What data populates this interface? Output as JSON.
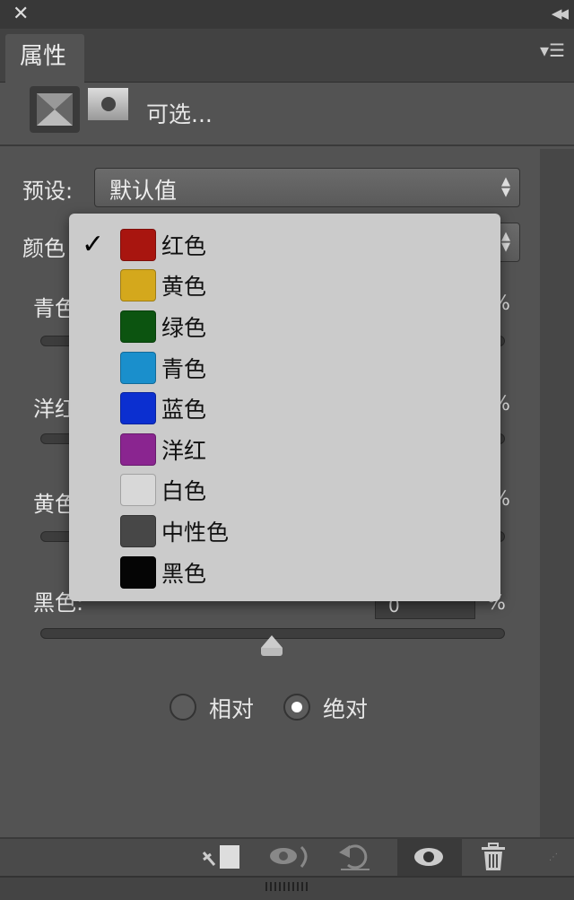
{
  "window": {
    "close_icon": "close-icon",
    "collapse_icon": "double-chevron-left-icon"
  },
  "tab": {
    "label": "属性",
    "menu_icon": "panel-menu-icon"
  },
  "header": {
    "type_label": "可选..."
  },
  "preset": {
    "label": "预设:",
    "value": "默认值"
  },
  "colors": {
    "label": "颜色",
    "selected": "红色"
  },
  "sliders": [
    {
      "label": "青色:",
      "unit": "%"
    },
    {
      "label": "洋红:",
      "unit": "%"
    },
    {
      "label": "黄色:",
      "unit": "%"
    },
    {
      "label": "黑色:",
      "value": "0",
      "unit": "%",
      "level": 0
    }
  ],
  "dropdown": {
    "items": [
      {
        "label": "红色",
        "color": "#a8150f",
        "checked": true
      },
      {
        "label": "黄色",
        "color": "#d4a81c"
      },
      {
        "label": "绿色",
        "color": "#0c5410"
      },
      {
        "label": "青色",
        "color": "#1a8fcc"
      },
      {
        "label": "蓝色",
        "color": "#0b2fd0"
      },
      {
        "label": "洋红",
        "color": "#8a2590"
      },
      {
        "label": "白色",
        "color": "#d8d8d8"
      },
      {
        "label": "中性色",
        "color": "#474747"
      },
      {
        "label": "黑色",
        "color": "#050505"
      }
    ]
  },
  "mode": {
    "relative": "相对",
    "absolute": "绝对",
    "selected": "absolute"
  },
  "toolbar": {
    "icons": [
      "clip-to-layer-icon",
      "view-previous-icon",
      "reset-icon",
      "visibility-eye-icon",
      "trash-icon"
    ]
  }
}
